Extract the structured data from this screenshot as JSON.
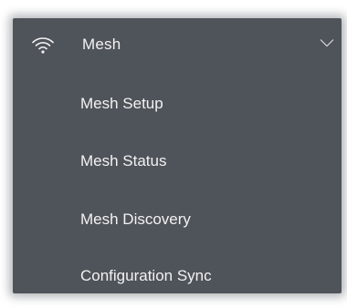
{
  "menu": {
    "header": {
      "label": "Mesh",
      "icon": "wifi-icon",
      "expand_icon": "chevron-down-icon"
    },
    "items": [
      {
        "label": "Mesh Setup"
      },
      {
        "label": "Mesh Status"
      },
      {
        "label": "Mesh Discovery"
      },
      {
        "label": "Configuration Sync"
      }
    ]
  },
  "colors": {
    "panel_background": "#4f535a",
    "text": "#f2f2f2"
  }
}
